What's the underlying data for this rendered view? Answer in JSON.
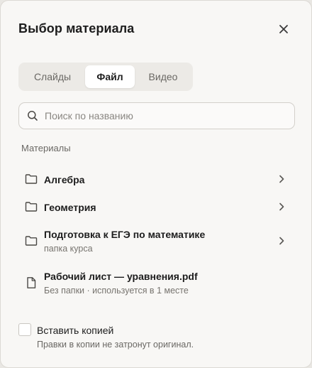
{
  "dialog": {
    "title": "Выбор материала",
    "close_icon": "close-icon"
  },
  "tabs": [
    {
      "label": "Слайды",
      "active": false
    },
    {
      "label": "Файл",
      "active": true
    },
    {
      "label": "Видео",
      "active": false
    }
  ],
  "search": {
    "placeholder": "Поиск по названию",
    "value": "",
    "icon": "search-icon"
  },
  "materials": {
    "section_label": "Материалы",
    "items": [
      {
        "name": "Алгебра",
        "subtitle": "",
        "icon": "folder-icon",
        "has_chevron": true
      },
      {
        "name": "Геометрия",
        "subtitle": "",
        "icon": "folder-icon",
        "has_chevron": true
      },
      {
        "name": "Подготовка к ЕГЭ по математике",
        "subtitle": "папка курса",
        "icon": "folder-icon",
        "has_chevron": true
      },
      {
        "name": "Рабочий лист — уравнения.pdf",
        "subtitle": "Без папки · используется в 1 месте",
        "icon": "file-icon",
        "has_chevron": false
      }
    ]
  },
  "copy_option": {
    "label": "Вставить копией",
    "hint": "Правки в копии не затронут оригинал.",
    "checked": false
  },
  "colors": {
    "background": "#f8f7f5",
    "tab_track": "#eceae6",
    "active_tab": "#ffffff",
    "text_primary": "#1d1d1d",
    "text_secondary": "#6a6864"
  }
}
